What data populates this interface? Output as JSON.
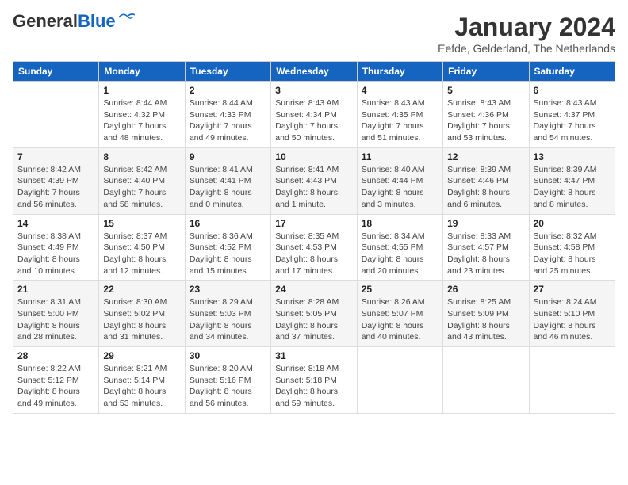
{
  "logo": {
    "text_general": "General",
    "text_blue": "Blue"
  },
  "title": "January 2024",
  "location": "Eefde, Gelderland, The Netherlands",
  "days_of_week": [
    "Sunday",
    "Monday",
    "Tuesday",
    "Wednesday",
    "Thursday",
    "Friday",
    "Saturday"
  ],
  "weeks": [
    [
      {
        "day": "",
        "sunrise": "",
        "sunset": "",
        "daylight": ""
      },
      {
        "day": "1",
        "sunrise": "Sunrise: 8:44 AM",
        "sunset": "Sunset: 4:32 PM",
        "daylight": "Daylight: 7 hours and 48 minutes."
      },
      {
        "day": "2",
        "sunrise": "Sunrise: 8:44 AM",
        "sunset": "Sunset: 4:33 PM",
        "daylight": "Daylight: 7 hours and 49 minutes."
      },
      {
        "day": "3",
        "sunrise": "Sunrise: 8:43 AM",
        "sunset": "Sunset: 4:34 PM",
        "daylight": "Daylight: 7 hours and 50 minutes."
      },
      {
        "day": "4",
        "sunrise": "Sunrise: 8:43 AM",
        "sunset": "Sunset: 4:35 PM",
        "daylight": "Daylight: 7 hours and 51 minutes."
      },
      {
        "day": "5",
        "sunrise": "Sunrise: 8:43 AM",
        "sunset": "Sunset: 4:36 PM",
        "daylight": "Daylight: 7 hours and 53 minutes."
      },
      {
        "day": "6",
        "sunrise": "Sunrise: 8:43 AM",
        "sunset": "Sunset: 4:37 PM",
        "daylight": "Daylight: 7 hours and 54 minutes."
      }
    ],
    [
      {
        "day": "7",
        "sunrise": "Sunrise: 8:42 AM",
        "sunset": "Sunset: 4:39 PM",
        "daylight": "Daylight: 7 hours and 56 minutes."
      },
      {
        "day": "8",
        "sunrise": "Sunrise: 8:42 AM",
        "sunset": "Sunset: 4:40 PM",
        "daylight": "Daylight: 7 hours and 58 minutes."
      },
      {
        "day": "9",
        "sunrise": "Sunrise: 8:41 AM",
        "sunset": "Sunset: 4:41 PM",
        "daylight": "Daylight: 8 hours and 0 minutes."
      },
      {
        "day": "10",
        "sunrise": "Sunrise: 8:41 AM",
        "sunset": "Sunset: 4:43 PM",
        "daylight": "Daylight: 8 hours and 1 minute."
      },
      {
        "day": "11",
        "sunrise": "Sunrise: 8:40 AM",
        "sunset": "Sunset: 4:44 PM",
        "daylight": "Daylight: 8 hours and 3 minutes."
      },
      {
        "day": "12",
        "sunrise": "Sunrise: 8:39 AM",
        "sunset": "Sunset: 4:46 PM",
        "daylight": "Daylight: 8 hours and 6 minutes."
      },
      {
        "day": "13",
        "sunrise": "Sunrise: 8:39 AM",
        "sunset": "Sunset: 4:47 PM",
        "daylight": "Daylight: 8 hours and 8 minutes."
      }
    ],
    [
      {
        "day": "14",
        "sunrise": "Sunrise: 8:38 AM",
        "sunset": "Sunset: 4:49 PM",
        "daylight": "Daylight: 8 hours and 10 minutes."
      },
      {
        "day": "15",
        "sunrise": "Sunrise: 8:37 AM",
        "sunset": "Sunset: 4:50 PM",
        "daylight": "Daylight: 8 hours and 12 minutes."
      },
      {
        "day": "16",
        "sunrise": "Sunrise: 8:36 AM",
        "sunset": "Sunset: 4:52 PM",
        "daylight": "Daylight: 8 hours and 15 minutes."
      },
      {
        "day": "17",
        "sunrise": "Sunrise: 8:35 AM",
        "sunset": "Sunset: 4:53 PM",
        "daylight": "Daylight: 8 hours and 17 minutes."
      },
      {
        "day": "18",
        "sunrise": "Sunrise: 8:34 AM",
        "sunset": "Sunset: 4:55 PM",
        "daylight": "Daylight: 8 hours and 20 minutes."
      },
      {
        "day": "19",
        "sunrise": "Sunrise: 8:33 AM",
        "sunset": "Sunset: 4:57 PM",
        "daylight": "Daylight: 8 hours and 23 minutes."
      },
      {
        "day": "20",
        "sunrise": "Sunrise: 8:32 AM",
        "sunset": "Sunset: 4:58 PM",
        "daylight": "Daylight: 8 hours and 25 minutes."
      }
    ],
    [
      {
        "day": "21",
        "sunrise": "Sunrise: 8:31 AM",
        "sunset": "Sunset: 5:00 PM",
        "daylight": "Daylight: 8 hours and 28 minutes."
      },
      {
        "day": "22",
        "sunrise": "Sunrise: 8:30 AM",
        "sunset": "Sunset: 5:02 PM",
        "daylight": "Daylight: 8 hours and 31 minutes."
      },
      {
        "day": "23",
        "sunrise": "Sunrise: 8:29 AM",
        "sunset": "Sunset: 5:03 PM",
        "daylight": "Daylight: 8 hours and 34 minutes."
      },
      {
        "day": "24",
        "sunrise": "Sunrise: 8:28 AM",
        "sunset": "Sunset: 5:05 PM",
        "daylight": "Daylight: 8 hours and 37 minutes."
      },
      {
        "day": "25",
        "sunrise": "Sunrise: 8:26 AM",
        "sunset": "Sunset: 5:07 PM",
        "daylight": "Daylight: 8 hours and 40 minutes."
      },
      {
        "day": "26",
        "sunrise": "Sunrise: 8:25 AM",
        "sunset": "Sunset: 5:09 PM",
        "daylight": "Daylight: 8 hours and 43 minutes."
      },
      {
        "day": "27",
        "sunrise": "Sunrise: 8:24 AM",
        "sunset": "Sunset: 5:10 PM",
        "daylight": "Daylight: 8 hours and 46 minutes."
      }
    ],
    [
      {
        "day": "28",
        "sunrise": "Sunrise: 8:22 AM",
        "sunset": "Sunset: 5:12 PM",
        "daylight": "Daylight: 8 hours and 49 minutes."
      },
      {
        "day": "29",
        "sunrise": "Sunrise: 8:21 AM",
        "sunset": "Sunset: 5:14 PM",
        "daylight": "Daylight: 8 hours and 53 minutes."
      },
      {
        "day": "30",
        "sunrise": "Sunrise: 8:20 AM",
        "sunset": "Sunset: 5:16 PM",
        "daylight": "Daylight: 8 hours and 56 minutes."
      },
      {
        "day": "31",
        "sunrise": "Sunrise: 8:18 AM",
        "sunset": "Sunset: 5:18 PM",
        "daylight": "Daylight: 8 hours and 59 minutes."
      },
      {
        "day": "",
        "sunrise": "",
        "sunset": "",
        "daylight": ""
      },
      {
        "day": "",
        "sunrise": "",
        "sunset": "",
        "daylight": ""
      },
      {
        "day": "",
        "sunrise": "",
        "sunset": "",
        "daylight": ""
      }
    ]
  ]
}
